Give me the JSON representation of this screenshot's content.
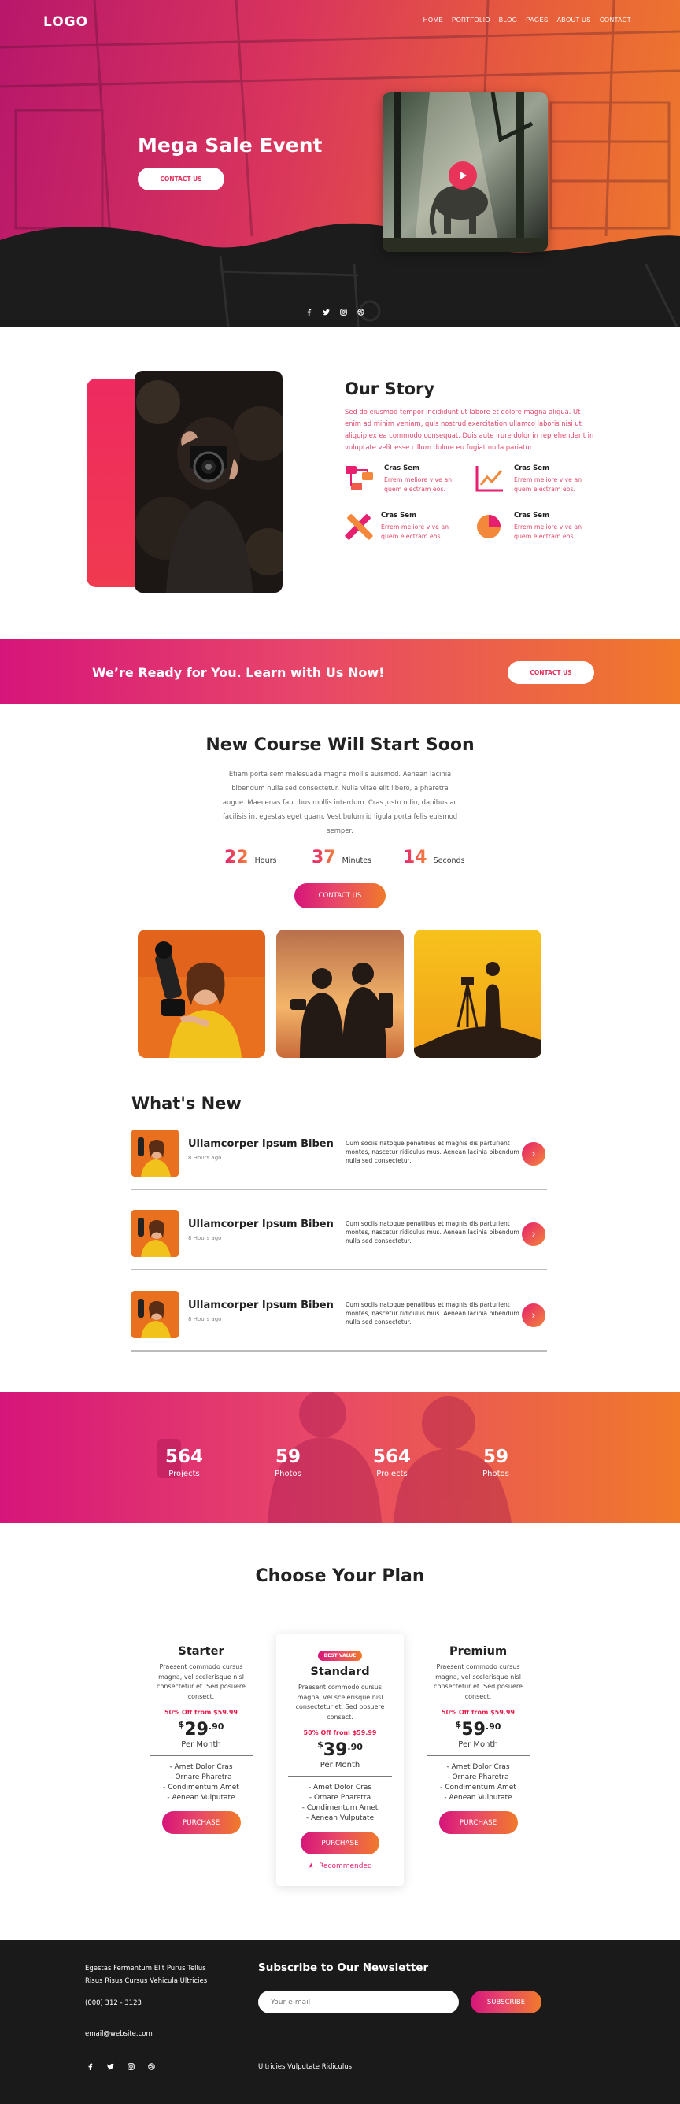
{
  "header": {
    "logo": "LOGO",
    "nav": [
      "HOME",
      "PORTFOLIO",
      "BLOG",
      "PAGES",
      "ABOUT US",
      "CONTACT"
    ]
  },
  "hero": {
    "title": "Mega Sale Event",
    "button": "CONTACT US",
    "social_icons": [
      "facebook-icon",
      "twitter-icon",
      "instagram-icon",
      "dribbble-icon"
    ]
  },
  "story": {
    "title": "Our Story",
    "text": "Sed do eiusmod tempor incididunt ut labore et dolore magna aliqua. Ut enim ad minim veniam, quis nostrud exercitation ullamco laboris nisi ut aliquip ex ea commodo consequat. Duis aute irure dolor in reprehenderit in voluptate velit esse cillum dolore eu fugiat nulla pariatur.",
    "features": [
      {
        "title": "Cras Sem",
        "desc": "Errem meliore vive an quem electram eos.",
        "icon": "network-icon"
      },
      {
        "title": "Cras Sem",
        "desc": "Errem meliore vive an quem electram eos.",
        "icon": "line-chart-icon"
      },
      {
        "title": "Cras Sem",
        "desc": "Errem meliore vive an quem electram eos.",
        "icon": "tools-icon"
      },
      {
        "title": "Cras Sem",
        "desc": "Errem meliore vive an quem electram eos.",
        "icon": "pie-chart-icon"
      }
    ]
  },
  "cta": {
    "text": "We’re Ready for You. Learn with Us Now!",
    "button": "CONTACT US"
  },
  "course": {
    "title": "New Course Will Start Soon",
    "text": "Etiam porta sem malesuada magna mollis euismod. Aenean lacinia bibendum nulla sed consectetur. Nulla vitae elit libero, a pharetra augue. Maecenas faucibus mollis interdum. Cras justo odio, dapibus ac facilisis in, egestas eget quam. Vestibulum id ligula porta felis euismod semper.",
    "countdown": [
      {
        "value": "22",
        "unit": "Hours"
      },
      {
        "value": "37",
        "unit": "Minutes"
      },
      {
        "value": "14",
        "unit": "Seconds"
      }
    ],
    "button": "CONTACT US"
  },
  "whats_new": {
    "title": "What's New",
    "items": [
      {
        "title": "Ullamcorper Ipsum Biben",
        "date": "8 Hours ago",
        "text": "Cum sociis natoque penatibus et magnis dis parturient montes, nascetur ridiculus mus. Aenean lacinia bibendum nulla sed consectetur."
      },
      {
        "title": "Ullamcorper Ipsum Biben",
        "date": "8 Hours ago",
        "text": "Cum sociis natoque penatibus et magnis dis parturient montes, nascetur ridiculus mus. Aenean lacinia bibendum nulla sed consectetur."
      },
      {
        "title": "Ullamcorper Ipsum Biben",
        "date": "8 Hours ago",
        "text": "Cum sociis natoque penatibus et magnis dis parturient montes, nascetur ridiculus mus. Aenean lacinia bibendum nulla sed consectetur."
      }
    ]
  },
  "stats": [
    {
      "value": "564",
      "label": "Projects"
    },
    {
      "value": "59",
      "label": "Photos"
    },
    {
      "value": "564",
      "label": "Projects"
    },
    {
      "value": "59",
      "label": "Photos"
    }
  ],
  "pricing": {
    "title": "Choose Your Plan",
    "plans": [
      {
        "name": "Starter",
        "desc": "Praesent commodo cursus magna, vel scelerisque nisl consectetur et. Sed posuere consect.",
        "offer": "50% Off from $59.99",
        "currency": "$",
        "price": "29",
        "cents": ".90",
        "period": "Per Month",
        "features": [
          "- Amet Dolor Cras",
          "- Ornare Pharetra",
          "- Condimentum Amet",
          "- Aenean Vulputate"
        ],
        "button": "PURCHASE"
      },
      {
        "name": "Standard",
        "badge": "BEST VALUE",
        "desc": "Praesent commodo cursus magna, vel scelerisque nisl consectetur et. Sed posuere consect.",
        "offer": "50% Off from $59.99",
        "currency": "$",
        "price": "39",
        "cents": ".90",
        "period": "Per Month",
        "features": [
          "- Amet Dolor Cras",
          "- Ornare Pharetra",
          "- Condimentum Amet",
          "- Aenean Vulputate"
        ],
        "button": "PURCHASE",
        "recommended": "Recommended"
      },
      {
        "name": "Premium",
        "desc": "Praesent commodo cursus magna, vel scelerisque nisl consectetur et. Sed posuere consect.",
        "offer": "50% Off from $59.99",
        "currency": "$",
        "price": "59",
        "cents": ".90",
        "period": "Per Month",
        "features": [
          "- Amet Dolor Cras",
          "- Ornare Pharetra",
          "- Condimentum Amet",
          "- Aenean Vulputate"
        ],
        "button": "PURCHASE"
      }
    ]
  },
  "footer": {
    "address_line1": "Egestas Fermentum Elit Purus Tellus",
    "address_line2": "Risus Risus Cursus Vehicula Ultricies",
    "phone": "(000) 312 - 3123",
    "email": "email@website.com",
    "newsletter_title": "Subscribe to Our Newsletter",
    "input_placeholder": "Your e-mail",
    "subscribe_button": "SUBSCRIBE",
    "tagline": "Ultricies Vulputate Ridiculus",
    "social_icons": [
      "facebook-icon",
      "twitter-icon",
      "instagram-icon",
      "dribbble-icon"
    ]
  },
  "colors": {
    "accent_pink": "#e61f6e",
    "accent_orange": "#f3873a",
    "footer_bg": "#1a1a1a"
  }
}
